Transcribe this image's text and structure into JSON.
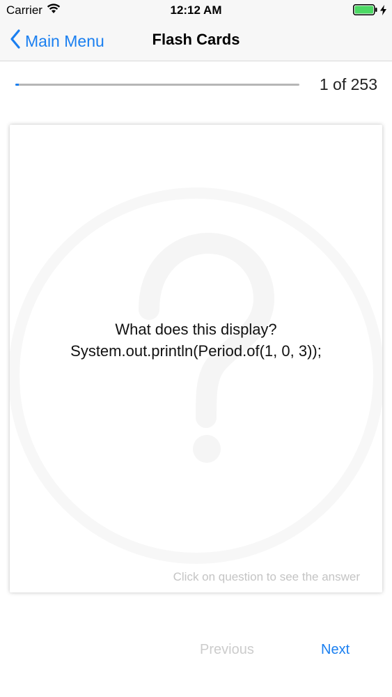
{
  "status_bar": {
    "carrier": "Carrier",
    "time": "12:12 AM",
    "icons": [
      "wifi-icon",
      "battery-icon",
      "charging-bolt-icon"
    ]
  },
  "nav": {
    "back_label": "Main Menu",
    "title": "Flash Cards"
  },
  "progress": {
    "count_text": "1 of 253",
    "current": 1,
    "total": 253
  },
  "card": {
    "question_line1": "What does this display?",
    "question_line2": "System.out.println(Period.of(1, 0, 3));",
    "hint": "Click on question to see the answer",
    "watermark_icon": "question-mark-icon"
  },
  "footer": {
    "previous_label": "Previous",
    "next_label": "Next"
  },
  "colors": {
    "accent": "#1a7ff0",
    "disabled": "#cccccc",
    "battery": "#4cd964"
  }
}
